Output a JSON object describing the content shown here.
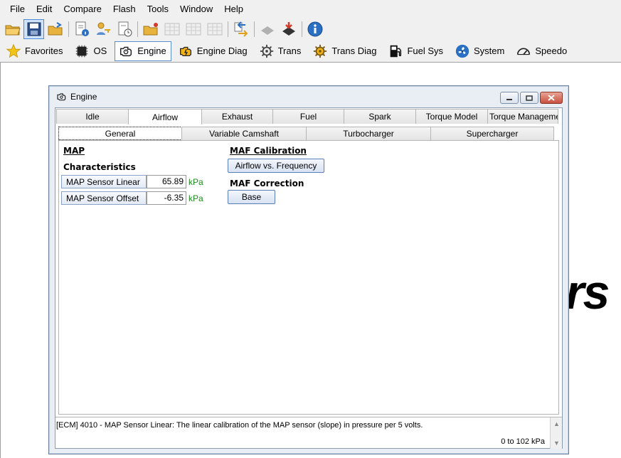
{
  "menu": [
    "File",
    "Edit",
    "Compare",
    "Flash",
    "Tools",
    "Window",
    "Help"
  ],
  "toolbar_icons": [
    "open-folder-icon",
    "save-icon",
    "open-recent-icon",
    "document-info-icon",
    "key-users-icon",
    "document-clock-icon",
    "folder-new-icon",
    "table-icon",
    "table-icon",
    "table-icon",
    "compare-arrows-icon",
    "chip-read-icon",
    "chip-write-icon",
    "info-icon"
  ],
  "categories": [
    {
      "label": "Favorites",
      "icon": "star-icon"
    },
    {
      "label": "OS",
      "icon": "chip-icon"
    },
    {
      "label": "Engine",
      "icon": "engine-icon"
    },
    {
      "label": "Engine Diag",
      "icon": "engine-warning-icon"
    },
    {
      "label": "Trans",
      "icon": "gear-icon"
    },
    {
      "label": "Trans Diag",
      "icon": "gear-warning-icon"
    },
    {
      "label": "Fuel Sys",
      "icon": "fuel-pump-icon"
    },
    {
      "label": "System",
      "icon": "fan-icon"
    },
    {
      "label": "Speedo",
      "icon": "speedometer-icon"
    }
  ],
  "background_text": "rs",
  "window": {
    "title": "Engine",
    "tabs": [
      "Idle",
      "Airflow",
      "Exhaust",
      "Fuel",
      "Spark",
      "Torque Model",
      "Torque Management"
    ],
    "subtabs": [
      "General",
      "Variable Camshaft",
      "Turbocharger",
      "Supercharger"
    ],
    "map": {
      "heading": "MAP",
      "characteristics": "Characteristics",
      "params": [
        {
          "label": "MAP Sensor Linear",
          "value": "65.89",
          "unit": "kPa"
        },
        {
          "label": "MAP Sensor Offset",
          "value": "-6.35",
          "unit": "kPa"
        }
      ]
    },
    "maf": {
      "calibration_heading": "MAF Calibration",
      "airflow_button": "Airflow vs. Frequency",
      "correction_heading": "MAF Correction",
      "base_button": "Base"
    },
    "status": {
      "text": "[ECM] 4010 - MAP Sensor Linear: The linear calibration of the MAP sensor (slope) in pressure per 5 volts.",
      "range": "0 to 102 kPa"
    }
  },
  "colors": {
    "unit": "#1f8a1f",
    "active_border": "#4a8ad6",
    "close": "#c85040"
  }
}
